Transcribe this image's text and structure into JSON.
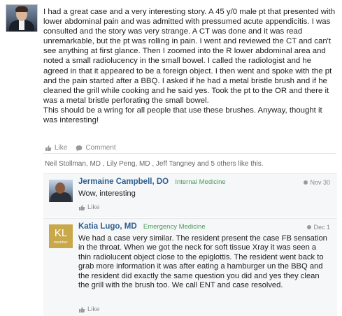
{
  "post": {
    "text": "I had a great case and a very interesting story. A 45 y/0 male pt that presented with lower abdominal pain and was admitted with pressumed acute appendicitis. I was consulted and the story was very strange. A CT was done and it was read unremarkable, but the pt was rolling in pain. I went and reviewed the CT and can't see anything at first glance. Then I zoomed into the R lower abdominal area and noted a small radiolucency in the small bowel. I called the radiologist and he agreed in that it appeared to be a foreign object. I then went and spoke with the pt and the pain started after a BBQ. I asked if he had a metal bristle brush and if he cleaned the grill while cooking and he said yes. Took the pt to the OR and there it was a metal bristle perforating the small bowel.\nThis should be a wring for all people that use these brushes. Anyway, thought it was interesting!",
    "actions": {
      "like": "Like",
      "comment": "Comment"
    },
    "likers": "Neil Stollman, MD , Lily Peng, MD , Jeff Tangney and 5 others like this."
  },
  "comments": [
    {
      "name": "Jermaine Campbell, DO",
      "specialty": "Internal Medicine",
      "date": "Nov 30",
      "text": "Wow, interesting",
      "like": "Like"
    },
    {
      "name": "Katia Lugo, MD",
      "specialty": "Emergency Medicine",
      "date": "Dec 1",
      "avatar_initials": "KL",
      "avatar_tag": "member",
      "text": "We had a case very similar. The resident present the case FB sensation in the throat. When we got the neck for soft tissue Xray it was seen a thin radiolucent object close to the epiglottis. The resident went back to grab more information it was after eating a hamburger un the BBQ and the resident did exactly the same question you did and yes they clean the grill with the brush too. We call ENT and case resolved.",
      "like": "Like"
    }
  ],
  "colors": {
    "name_link": "#2f5f8f",
    "specialty": "#4a9a5a",
    "avatar_kl": "#c9a84a"
  },
  "icons": [
    "thumbs-up-icon",
    "comment-icon",
    "clock-dot-icon"
  ]
}
